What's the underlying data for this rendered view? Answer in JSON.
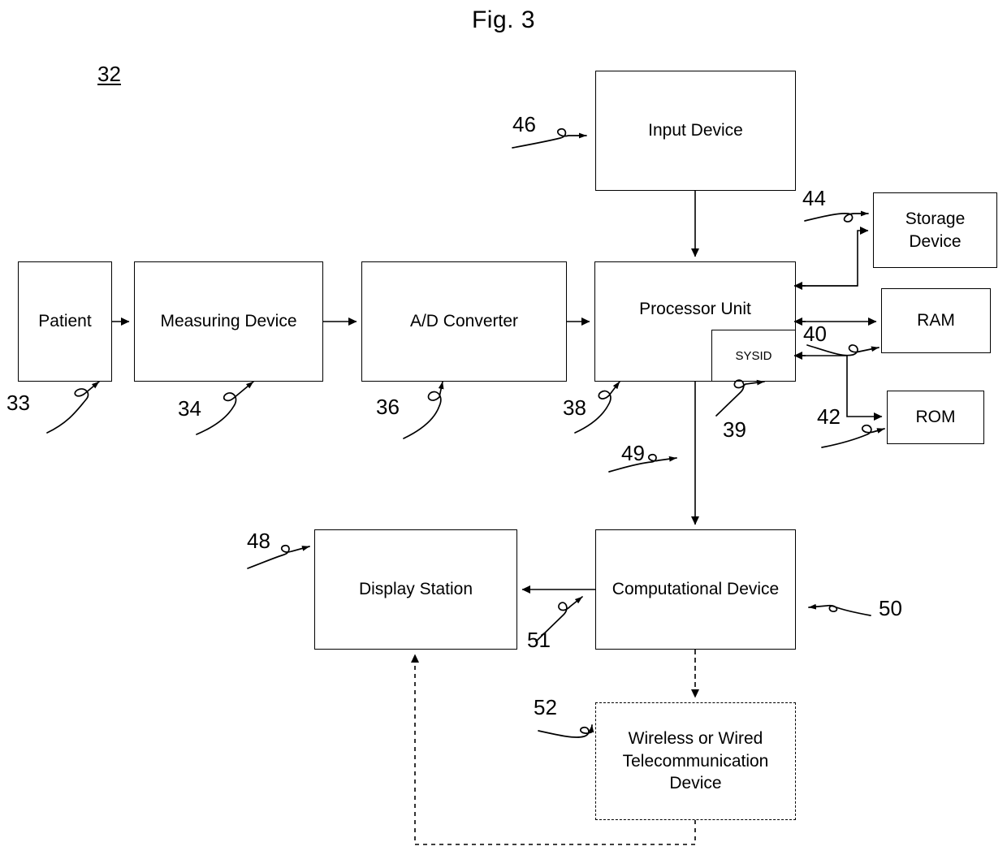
{
  "figure": {
    "title": "Fig. 3",
    "system_number": "32"
  },
  "blocks": [
    {
      "id": "patient",
      "label": "Patient",
      "ref": "33"
    },
    {
      "id": "measuring",
      "label": "Measuring Device",
      "ref": "34"
    },
    {
      "id": "adconverter",
      "label": "A/D Converter",
      "ref": "36"
    },
    {
      "id": "processor",
      "label": "Processor Unit",
      "ref": "38"
    },
    {
      "id": "sysid",
      "label": "SYSID",
      "ref": "39"
    },
    {
      "id": "input",
      "label": "Input Device",
      "ref": "46"
    },
    {
      "id": "storage",
      "label": "Storage Device",
      "ref": "44"
    },
    {
      "id": "ram",
      "label": "RAM",
      "ref": "40"
    },
    {
      "id": "rom",
      "label": "ROM",
      "ref": "42"
    },
    {
      "id": "display",
      "label": "Display Station",
      "ref": "48"
    },
    {
      "id": "computational",
      "label": "Computational Device",
      "ref": "50"
    },
    {
      "id": "telecom",
      "label": "Wireless or Wired Telecommunication Device",
      "ref": "52"
    }
  ],
  "connection_refs": {
    "processor_to_computational": "49",
    "computational_to_display": "51"
  },
  "refs": {
    "r32": "32",
    "r33": "33",
    "r34": "34",
    "r36": "36",
    "r38": "38",
    "r39": "39",
    "r40": "40",
    "r42": "42",
    "r44": "44",
    "r46": "46",
    "r48": "48",
    "r49": "49",
    "r50": "50",
    "r51": "51",
    "r52": "52"
  },
  "labels": {
    "patient": "Patient",
    "measuring_device": "Measuring Device",
    "ad_converter": "A/D Converter",
    "processor_unit": "Processor Unit",
    "sysid": "SYSID",
    "input_device": "Input Device",
    "storage_device": "Storage Device",
    "ram": "RAM",
    "rom": "ROM",
    "display_station": "Display Station",
    "computational_device": "Computational Device",
    "telecom_device": "Wireless or Wired Telecommunication Device"
  },
  "colors": {
    "stroke": "#000000",
    "background": "#ffffff"
  }
}
